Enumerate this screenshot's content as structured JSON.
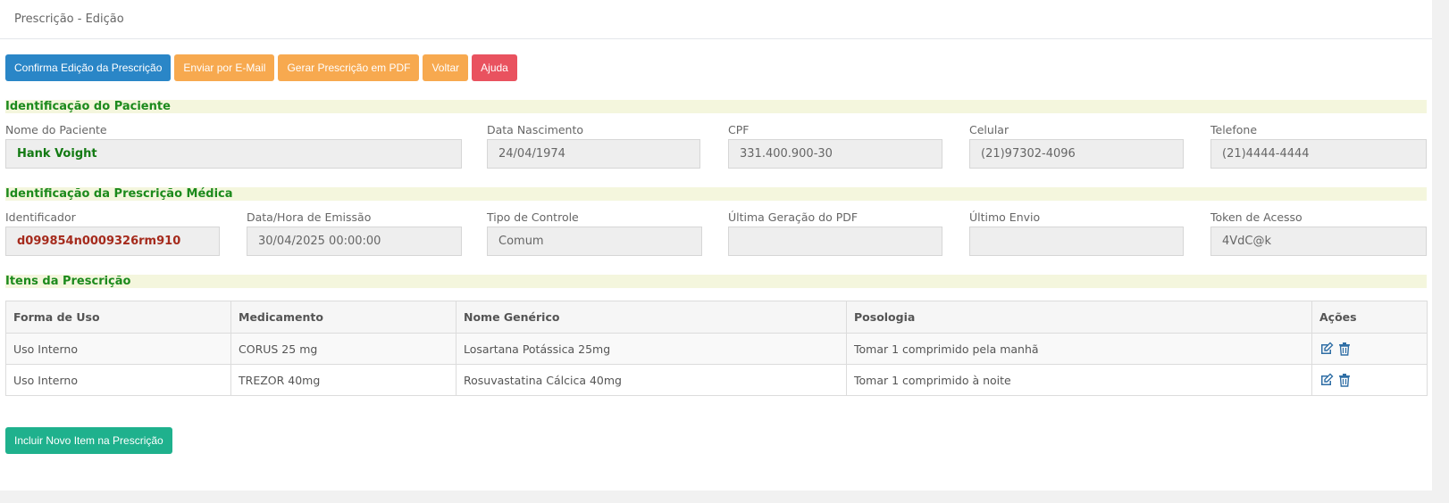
{
  "header": {
    "title": "Prescrição - Edição"
  },
  "toolbar": {
    "confirm": "Confirma Edição da Prescrição",
    "email": "Enviar por E-Mail",
    "pdf": "Gerar Prescrição em PDF",
    "back": "Voltar",
    "help": "Ajuda"
  },
  "patient": {
    "section": "Identificação do Paciente",
    "name_label": "Nome do Paciente",
    "name": "Hank Voight",
    "birth_label": "Data Nascimento",
    "birth": "24/04/1974",
    "cpf_label": "CPF",
    "cpf": "331.400.900-30",
    "cell_label": "Celular",
    "cell": "(21)97302-4096",
    "phone_label": "Telefone",
    "phone": "(21)4444-4444"
  },
  "prescription": {
    "section": "Identificação da Prescrição Médica",
    "id_label": "Identificador",
    "id": "d099854n0009326rm910",
    "date_label": "Data/Hora de Emissão",
    "date": "30/04/2025 00:00:00",
    "type_label": "Tipo de Controle",
    "type": "Comum",
    "pdf_label": "Última Geração do PDF",
    "pdf": "",
    "sent_label": "Último Envio",
    "sent": "",
    "token_label": "Token de Acesso",
    "token": "4VdC@k"
  },
  "items": {
    "section": "Itens da Prescrição",
    "columns": [
      "Forma de Uso",
      "Medicamento",
      "Nome Genérico",
      "Posologia",
      "Ações"
    ],
    "rows": [
      {
        "use": "Uso Interno",
        "drug": "CORUS 25 mg",
        "generic": "Losartana Potássica 25mg",
        "dosage": "Tomar 1 comprimido pela manhã"
      },
      {
        "use": "Uso Interno",
        "drug": "TREZOR 40mg",
        "generic": "Rosuvastatina Cálcica 40mg",
        "dosage": "Tomar 1 comprimido à noite"
      }
    ],
    "add_button": "Incluir Novo Item na Prescrição"
  },
  "icons": {
    "edit": "edit-icon",
    "delete": "trash-icon"
  },
  "colors": {
    "primary": "#2a86c7",
    "warning": "#f7a94f",
    "danger": "#e9525f",
    "success": "#1fb18d",
    "section_text": "#1c8a1c"
  }
}
